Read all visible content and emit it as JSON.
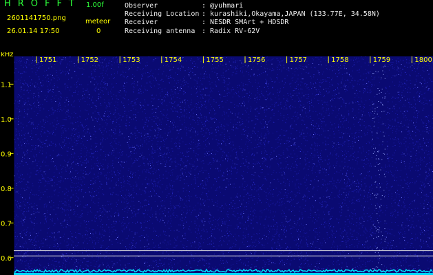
{
  "header": {
    "app_title": "HROFFT",
    "version": "1.00f",
    "filename": "2601141750.png",
    "timestamp": "26.01.14 17:50",
    "meteor_label": "meteor",
    "meteor_count": "0",
    "info_labels": "Observer\nReceiving Location\nReceiver\nReceiving antenna",
    "info_values": ": @yuhmari\n: kurashiki,Okayama,JAPAN (133.77E, 34.58N)\n: NESDR SMArt + HDSDR\n: Radix RV-62V",
    "colors": {
      "green": "#2dff3a",
      "yellow": "#ffff00",
      "white": "#f0f0f0",
      "background": "#000000",
      "waterfall": "#0a0a7a",
      "signal": "#00e5ff"
    }
  },
  "chart_data": {
    "type": "heatmap",
    "title": "",
    "ylabel": "kHz",
    "x_ticks": [
      "1751",
      "1752",
      "1753",
      "1754",
      "1755",
      "1756",
      "1757",
      "1758",
      "1759",
      "1800"
    ],
    "y_ticks": [
      "1.1",
      "1.0",
      "0.9",
      "0.8",
      "0.7",
      "0.6"
    ],
    "ylim": [
      0.55,
      1.18
    ],
    "notes": [
      "vertical brighter noise band near 1758",
      "horizontal reference lines near 0.62 kHz"
    ]
  }
}
